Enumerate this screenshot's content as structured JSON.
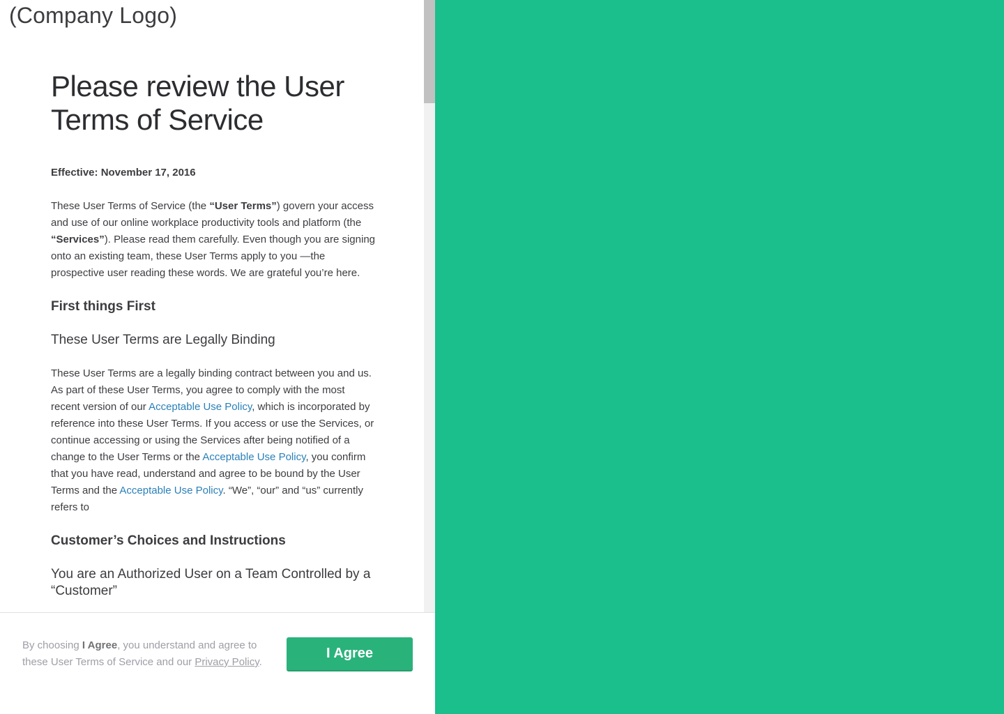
{
  "logo": {
    "text": "(Company Logo)"
  },
  "document": {
    "title": "Please review the User Terms of Service",
    "effective": "Effective: November 17, 2016",
    "intro": {
      "t1": "These User Terms of Service (the ",
      "b1": "“User Terms”",
      "t2": ") govern your access and use of our online workplace productivity tools and platform (the ",
      "b2": "“Services”",
      "t3": "). Please read them carefully. Even though you are signing onto an existing team, these User Terms apply to you —the prospective user reading these words. We are grateful you’re here."
    },
    "section1_heading": "First things First",
    "section1_subheading": "These User Terms are Legally Binding",
    "binding": {
      "t1": "These User Terms are a legally binding contract between you and us. As part of these User Terms, you agree to comply with the most recent version of our ",
      "link1": "Acceptable Use Policy",
      "t2": ", which is incorporated by reference into these User Terms. If you access or use the Services, or continue accessing or using the Services after being notified of a change to the User Terms or the ",
      "link2": "Acceptable Use Policy",
      "t3": ", you confirm that you have read, understand and agree to be bound by the User Terms and the ",
      "link3": "Acceptable Use Policy",
      "t4": ". “We”, “our” and “us” currently refers to"
    },
    "section2_heading": "Customer’s Choices and Instructions",
    "section2_subheading": "You are an Authorized User on a Team Controlled by a “Customer”"
  },
  "footer": {
    "t1": "By choosing ",
    "b1": "I Agree",
    "t2": ", you understand and agree to these User Terms of Service and our ",
    "privacy_link": "Privacy Policy",
    "t3": ".",
    "agree_label": "I Agree"
  },
  "colors": {
    "accent_panel": "#1abf8c",
    "agree_button": "#2ab27b",
    "link": "#2a80b9"
  }
}
